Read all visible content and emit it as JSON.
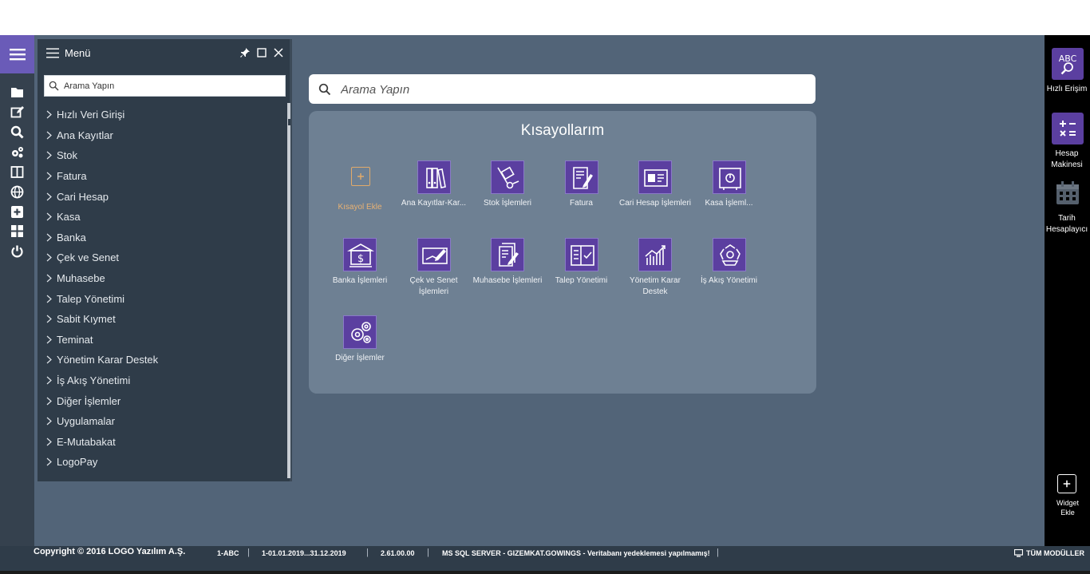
{
  "menu": {
    "title": "Menü",
    "search_placeholder": "Arama Yapın",
    "items": [
      "Hızlı Veri Girişi",
      "Ana Kayıtlar",
      "Stok",
      "Fatura",
      "Cari Hesap",
      "Kasa",
      "Banka",
      "Çek ve Senet",
      "Muhasebe",
      "Talep Yönetimi",
      "Sabit Kıymet",
      "Teminat",
      "Yönetim Karar Destek",
      "İş Akış Yönetimi",
      "Diğer İşlemler",
      "Uygulamalar",
      "E-Mutabakat",
      "LogoPay"
    ]
  },
  "main": {
    "search_placeholder": "Arama Yapın",
    "shortcuts_title": "Kısayollarım",
    "add_label": "Kısayol Ekle",
    "tiles": [
      {
        "label": "Ana Kayıtlar-Kar...",
        "icon": "binders-icon"
      },
      {
        "label": "Stok İşlemleri",
        "icon": "hand-truck-icon"
      },
      {
        "label": "Fatura",
        "icon": "invoice-pen-icon"
      },
      {
        "label": "Cari Hesap İşlemleri",
        "icon": "id-card-icon"
      },
      {
        "label": "Kasa İşleml...",
        "icon": "safe-icon"
      },
      {
        "label": "Banka İşlemleri",
        "icon": "bank-icon"
      },
      {
        "label": "Çek ve Senet İşlemleri",
        "icon": "cheque-icon"
      },
      {
        "label": "Muhasebe İşlemleri",
        "icon": "ledger-pen-icon"
      },
      {
        "label": "Talep Yönetimi",
        "icon": "checklist-icon"
      },
      {
        "label": "Yönetim Karar Destek",
        "icon": "growth-chart-icon"
      },
      {
        "label": "İş Akış Yönetimi",
        "icon": "recycle-flow-icon"
      },
      {
        "label": "Diğer İşlemler",
        "icon": "gears-icon"
      }
    ]
  },
  "rightbar": {
    "quick_access": "Hızlı Erişim",
    "calculator": "Hesap Makinesi",
    "date_calc": "Tarih Hesaplayıcı",
    "widget_add": "Widget Ekle",
    "quick_access_icon_text": "ABC"
  },
  "status": {
    "copyright": "Copyright © 2016 LOGO Yazılım A.Ş.",
    "firm": "1-ABC",
    "period": "1-01.01.2019...31.12.2019",
    "version": "2.61.00.00",
    "server": "MS SQL SERVER - GIZEMKAT.GOWINGS - Veritabanı yedeklemesi yapılmamış!",
    "modules": "TÜM MODÜLLER"
  },
  "colors": {
    "accent": "#6a5bb8",
    "tile_bg": "#5b3fa0",
    "background": "#526478",
    "panel": "#2f3c49",
    "add_orange": "#e8b173"
  }
}
